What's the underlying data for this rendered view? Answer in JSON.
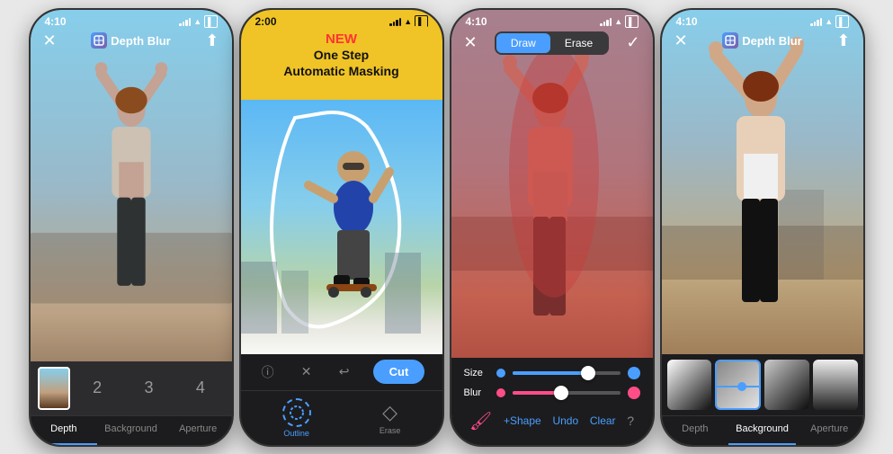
{
  "phones": [
    {
      "id": "phone1",
      "status_time": "4:10",
      "title": "Depth Blur",
      "tabs": [
        "Depth",
        "Background",
        "Aperture"
      ],
      "active_tab": 0,
      "thumbnails": [
        "",
        "2",
        "3",
        "4"
      ]
    },
    {
      "id": "phone2",
      "status_time": "2:00",
      "badge_new": "NEW",
      "badge_text": "One Step\nAutomatic Masking",
      "toolbar_buttons": [
        "ⓘ",
        "✕",
        "↩"
      ],
      "cut_label": "Cut",
      "tool_labels": [
        "Outline",
        "Erase"
      ]
    },
    {
      "id": "phone3",
      "status_time": "4:10",
      "draw_label": "Draw",
      "erase_label": "Erase",
      "size_label": "Size",
      "blur_label": "Blur",
      "bottom_controls": [
        "Brush",
        "+Shape",
        "Undo",
        "Clear",
        "?"
      ]
    },
    {
      "id": "phone4",
      "status_time": "4:10",
      "title": "Depth Blur",
      "tabs": [
        "Depth",
        "Background",
        "Aperture"
      ],
      "active_tab": 1
    }
  ],
  "colors": {
    "accent": "#4a9eff",
    "pink": "#ff4d88",
    "dark_bg": "#1c1c1e",
    "tab_active": "#4a9eff",
    "badge_yellow": "#f0c426",
    "badge_red": "#ff3333"
  }
}
